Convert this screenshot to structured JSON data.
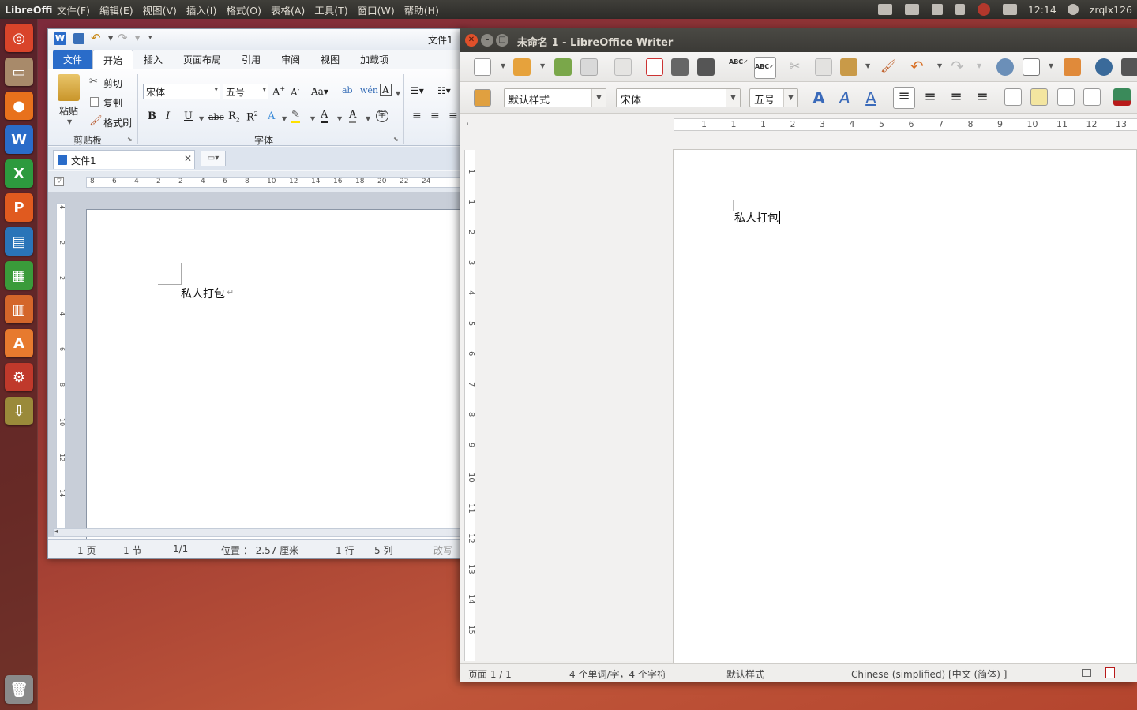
{
  "top_panel": {
    "app_name": "LibreOffice Writer",
    "menus": [
      "文件(F)",
      "编辑(E)",
      "视图(V)",
      "插入(I)",
      "格式(O)",
      "表格(A)",
      "工具(T)",
      "窗口(W)",
      "帮助(H)"
    ],
    "clock": "12:14",
    "user": "zrqlx126",
    "indicator_icons": [
      "keyboard-layout-icon",
      "calendar-icon",
      "attachment-icon",
      "network-icon",
      "input-method-icon",
      "volume-icon"
    ]
  },
  "launcher": {
    "items": [
      {
        "name": "dash-home-icon",
        "glyph": "◎",
        "color": "#d9442a"
      },
      {
        "name": "files-icon",
        "glyph": "▭",
        "color": "#a88a6a"
      },
      {
        "name": "firefox-icon",
        "glyph": "●",
        "color": "#e8711c"
      },
      {
        "name": "wps-writer-icon",
        "glyph": "W",
        "color": "#2a6cc9"
      },
      {
        "name": "wps-spreadsheet-icon",
        "glyph": "X",
        "color": "#2d9a3e"
      },
      {
        "name": "wps-presentation-icon",
        "glyph": "P",
        "color": "#e05a1f"
      },
      {
        "name": "libreoffice-writer-icon",
        "glyph": "▤",
        "color": "#2a74b8"
      },
      {
        "name": "libreoffice-calc-icon",
        "glyph": "▦",
        "color": "#3a9b3a"
      },
      {
        "name": "libreoffice-impress-icon",
        "glyph": "▥",
        "color": "#d4662a"
      },
      {
        "name": "software-center-icon",
        "glyph": "A",
        "color": "#e77a2e"
      },
      {
        "name": "system-settings-icon",
        "glyph": "⚙",
        "color": "#c0392b"
      },
      {
        "name": "software-updater-icon",
        "glyph": "⇩",
        "color": "#9a8a3a"
      }
    ],
    "trash": "trash-icon"
  },
  "wps": {
    "title": "文件1",
    "tabs": [
      "文件",
      "开始",
      "插入",
      "页面布局",
      "引用",
      "审阅",
      "视图",
      "加载项"
    ],
    "active_tab": "开始",
    "clipboard": {
      "paste": "粘贴",
      "cut": "剪切",
      "copy": "复制",
      "format_painter": "格式刷",
      "group": "剪贴板"
    },
    "font": {
      "name": "宋体",
      "size": "五号",
      "group": "字体"
    },
    "doc_tab": "文件1",
    "ruler_ticks": [
      "8",
      "6",
      "4",
      "2",
      "2",
      "4",
      "6",
      "8",
      "10",
      "12",
      "14",
      "16",
      "18",
      "20",
      "22",
      "24"
    ],
    "vruler_ticks": [
      "4",
      "2",
      "2",
      "4",
      "6",
      "8",
      "10",
      "12",
      "14"
    ],
    "content": "私人打包",
    "status": {
      "page": "1 页",
      "section": "1 节",
      "pages": "1/1",
      "position": "位置 ： 2.57 厘米",
      "line": "1 行",
      "col": "5 列",
      "overwrite": "改写"
    }
  },
  "lo": {
    "title": "未命名 1 - LibreOffice Writer",
    "para_style": "默认样式",
    "font_name": "宋体",
    "font_size": "五号",
    "ruler_ticks": [
      "1",
      "1",
      "1",
      "2",
      "3",
      "4",
      "5",
      "6",
      "7",
      "8",
      "9",
      "10",
      "11",
      "12",
      "13"
    ],
    "vruler_ticks": [
      "1",
      "1",
      "2",
      "3",
      "4",
      "5",
      "6",
      "7",
      "8",
      "9",
      "10",
      "11",
      "12",
      "13",
      "14",
      "15"
    ],
    "content": "私人打包",
    "status": {
      "page": "页面 1 / 1",
      "words": "4 个单词/字，4 个字符",
      "style": "默认样式",
      "language": "Chinese (simplified) [中文 (简体) ]"
    }
  }
}
